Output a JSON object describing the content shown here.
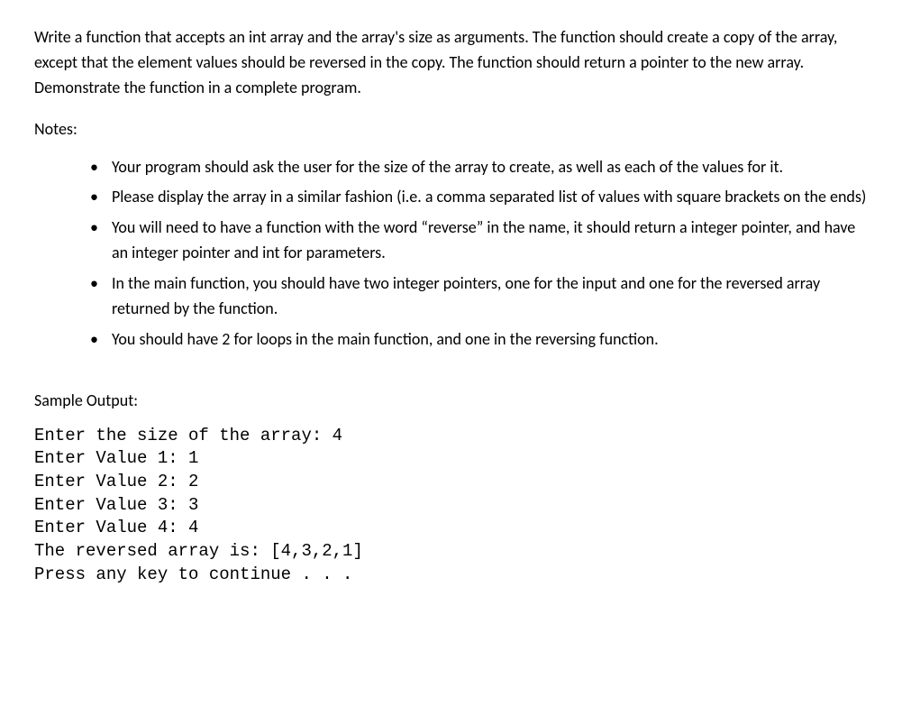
{
  "intro": "Write a function that accepts an int array and the array's size as arguments.  The function should create a copy of the array, except that the element values should be reversed in the copy.  The function should return a pointer to the new array.  Demonstrate the function in a complete program.",
  "notes_heading": "Notes:",
  "notes": [
    "Your program should ask the user for the size of the array to create, as well as each of the values for it.",
    "Please display the array in a similar fashion (i.e. a comma separated list of values with square brackets on the ends)",
    "You will need to have a function with the word “reverse” in the name, it should return a integer pointer, and have an integer pointer and int for parameters.",
    "In the main function, you should have two integer pointers, one for the input and one for the reversed array returned by the function.",
    "You should have 2 for loops in the main function, and one in the reversing function."
  ],
  "sample_heading": "Sample Output:",
  "sample_output": "Enter the size of the array: 4\nEnter Value 1: 1\nEnter Value 2: 2\nEnter Value 3: 3\nEnter Value 4: 4\nThe reversed array is: [4,3,2,1]\nPress any key to continue . . ."
}
